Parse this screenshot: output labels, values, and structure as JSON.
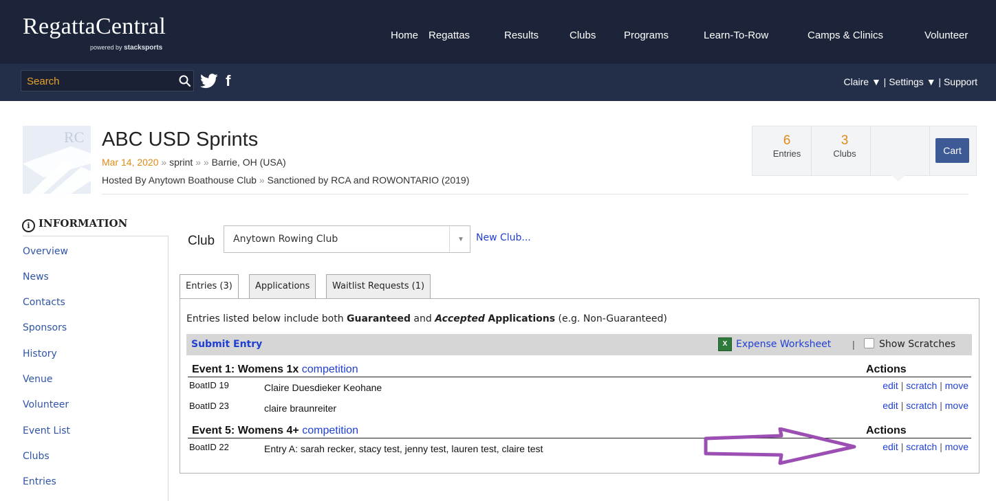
{
  "header": {
    "logo_text": "RegattaCentral",
    "logo_powered": "powered by",
    "logo_brand": "stacksports",
    "nav": [
      "Home",
      "Regattas",
      "Results",
      "Clubs",
      "Programs",
      "Learn-To-Row",
      "Camps & Clinics",
      "Volunteer"
    ]
  },
  "subbar": {
    "search_label": "Search",
    "user_links": "Claire ▼ | Settings ▼ | Support"
  },
  "event": {
    "title": "ABC USD Sprints",
    "date": "Mar 14, 2020",
    "sep1": "»",
    "type": "sprint",
    "sep2": "»",
    "sep3": "»",
    "location": "Barrie, OH (USA)",
    "hosted_by": "Hosted By Anytown Boathouse Club",
    "sep4": "»",
    "sanctioned": "Sanctioned by RCA and ROWONTARIO (2019)",
    "logo_initials": "RC"
  },
  "stats": {
    "entries_num": "6",
    "entries_label": "Entries",
    "clubs_num": "3",
    "clubs_label": "Clubs",
    "cart_label": "Cart"
  },
  "sidebar": {
    "header": "INFORMATION",
    "header_icon": "i",
    "items": [
      "Overview",
      "News",
      "Contacts",
      "Sponsors",
      "History",
      "Venue",
      "Volunteer",
      "Event List",
      "Clubs",
      "Entries"
    ]
  },
  "club_picker": {
    "label": "Club",
    "selected": "Anytown Rowing Club",
    "arrow": "▼",
    "new_club": "New Club..."
  },
  "tabs": [
    "Entries (3)",
    "Applications",
    "Waitlist Requests (1)"
  ],
  "entries_panel": {
    "note_pre": "Entries listed below include both",
    "note_guaranteed": "Guaranteed",
    "note_and": "and",
    "note_accepted": "Accepted",
    "note_applications": "Applications",
    "note_post": "(e.g. Non-Guaranteed)",
    "submit_entry": "Submit Entry",
    "xls_icon_text": "X",
    "expense_worksheet": "Expense Worksheet",
    "pipe": "|",
    "show_scratches": "Show Scratches",
    "events": [
      {
        "name": "Event 1: Womens 1x",
        "link": "competition",
        "actions_label": "Actions",
        "rows": [
          {
            "boat_id": "BoatID 19",
            "name": "Claire Duesdieker Keohane",
            "edit": "edit",
            "scratch": "scratch",
            "move": "move",
            "sep": "|"
          },
          {
            "boat_id": "BoatID 23",
            "name": "claire braunreiter",
            "edit": "edit",
            "scratch": "scratch",
            "move": "move",
            "sep": "|"
          }
        ]
      },
      {
        "name": "Event 5: Womens 4+",
        "link": "competition",
        "actions_label": "Actions",
        "rows": [
          {
            "boat_id": "BoatID 22",
            "name": "Entry A: sarah recker, stacy test, jenny test, lauren test, claire test",
            "edit": "edit",
            "scratch": "scratch",
            "move": "move",
            "sep": "|"
          }
        ]
      }
    ]
  },
  "colors": {
    "nav_bg": "#1b2438",
    "subbar_bg": "#232e48",
    "accent_orange": "#e08a16",
    "link_blue": "#1f3fd2",
    "cart_blue": "#3d5a97",
    "annotation_arrow": "#9b4fb3"
  },
  "icons": [
    "search-icon",
    "twitter-icon",
    "facebook-icon",
    "info-icon",
    "excel-icon",
    "annotation-arrow-icon"
  ]
}
